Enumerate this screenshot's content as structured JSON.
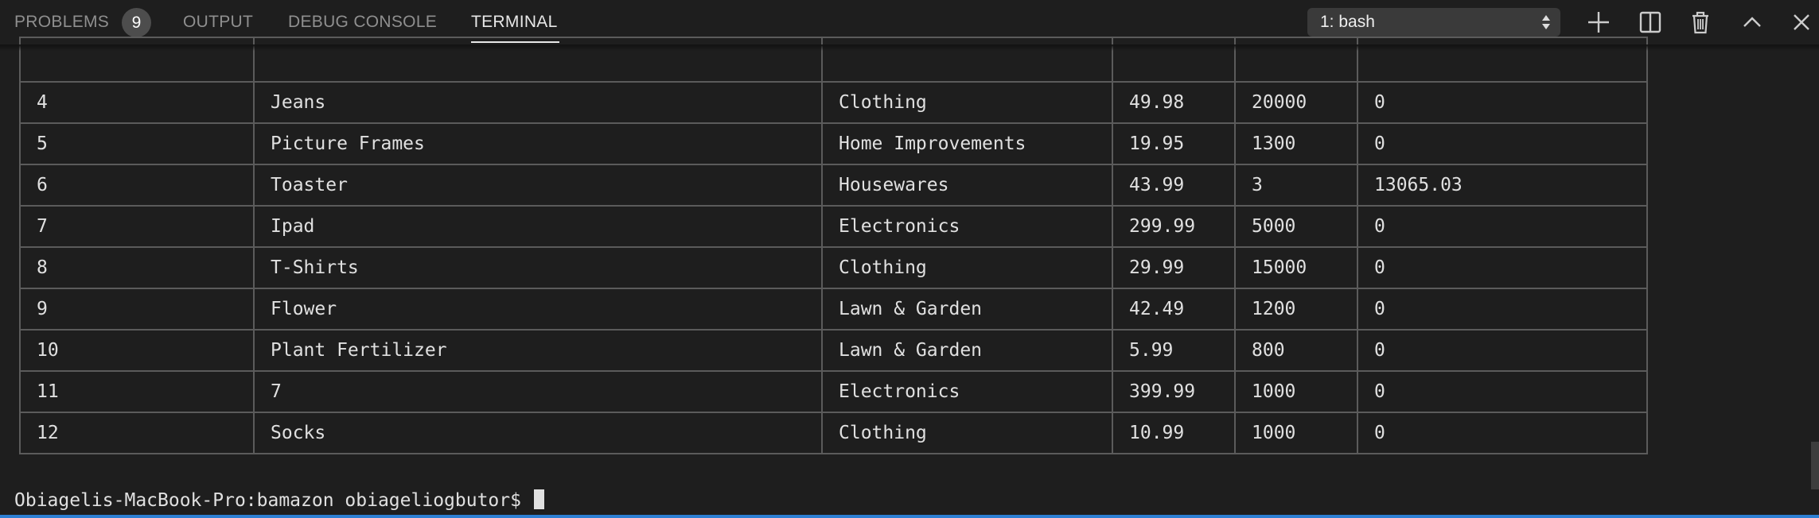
{
  "tabs": {
    "problems": "PROBLEMS",
    "problems_count": "9",
    "output": "OUTPUT",
    "debug_console": "DEBUG CONSOLE",
    "terminal": "TERMINAL"
  },
  "terminal_select": {
    "selected": "1: bash"
  },
  "toolbar_icons": [
    "add-icon",
    "split-icon",
    "trash-icon",
    "chevron-up-icon",
    "close-icon"
  ],
  "table": {
    "rows": [
      [
        "4",
        "Jeans",
        "Clothing",
        "49.98",
        "20000",
        "0"
      ],
      [
        "5",
        "Picture Frames",
        "Home Improvements",
        "19.95",
        "1300",
        "0"
      ],
      [
        "6",
        "Toaster",
        "Housewares",
        "43.99",
        "3",
        "13065.03"
      ],
      [
        "7",
        "Ipad",
        "Electronics",
        "299.99",
        "5000",
        "0"
      ],
      [
        "8",
        "T-Shirts",
        "Clothing",
        "29.99",
        "15000",
        "0"
      ],
      [
        "9",
        "Flower",
        "Lawn & Garden",
        "42.49",
        "1200",
        "0"
      ],
      [
        "10",
        "Plant Fertilizer",
        "Lawn & Garden",
        "5.99",
        "800",
        "0"
      ],
      [
        "11",
        "7",
        "Electronics",
        "399.99",
        "1000",
        "0"
      ],
      [
        "12",
        "Socks",
        "Clothing",
        "10.99",
        "1000",
        "0"
      ]
    ]
  },
  "prompt": {
    "text": "Obiagelis-MacBook-Pro:bamazon obiageliogbutor$"
  },
  "colors": {
    "background": "#1e1e1e",
    "border": "#5b5b5b",
    "status_bar": "#2d7fd3"
  }
}
